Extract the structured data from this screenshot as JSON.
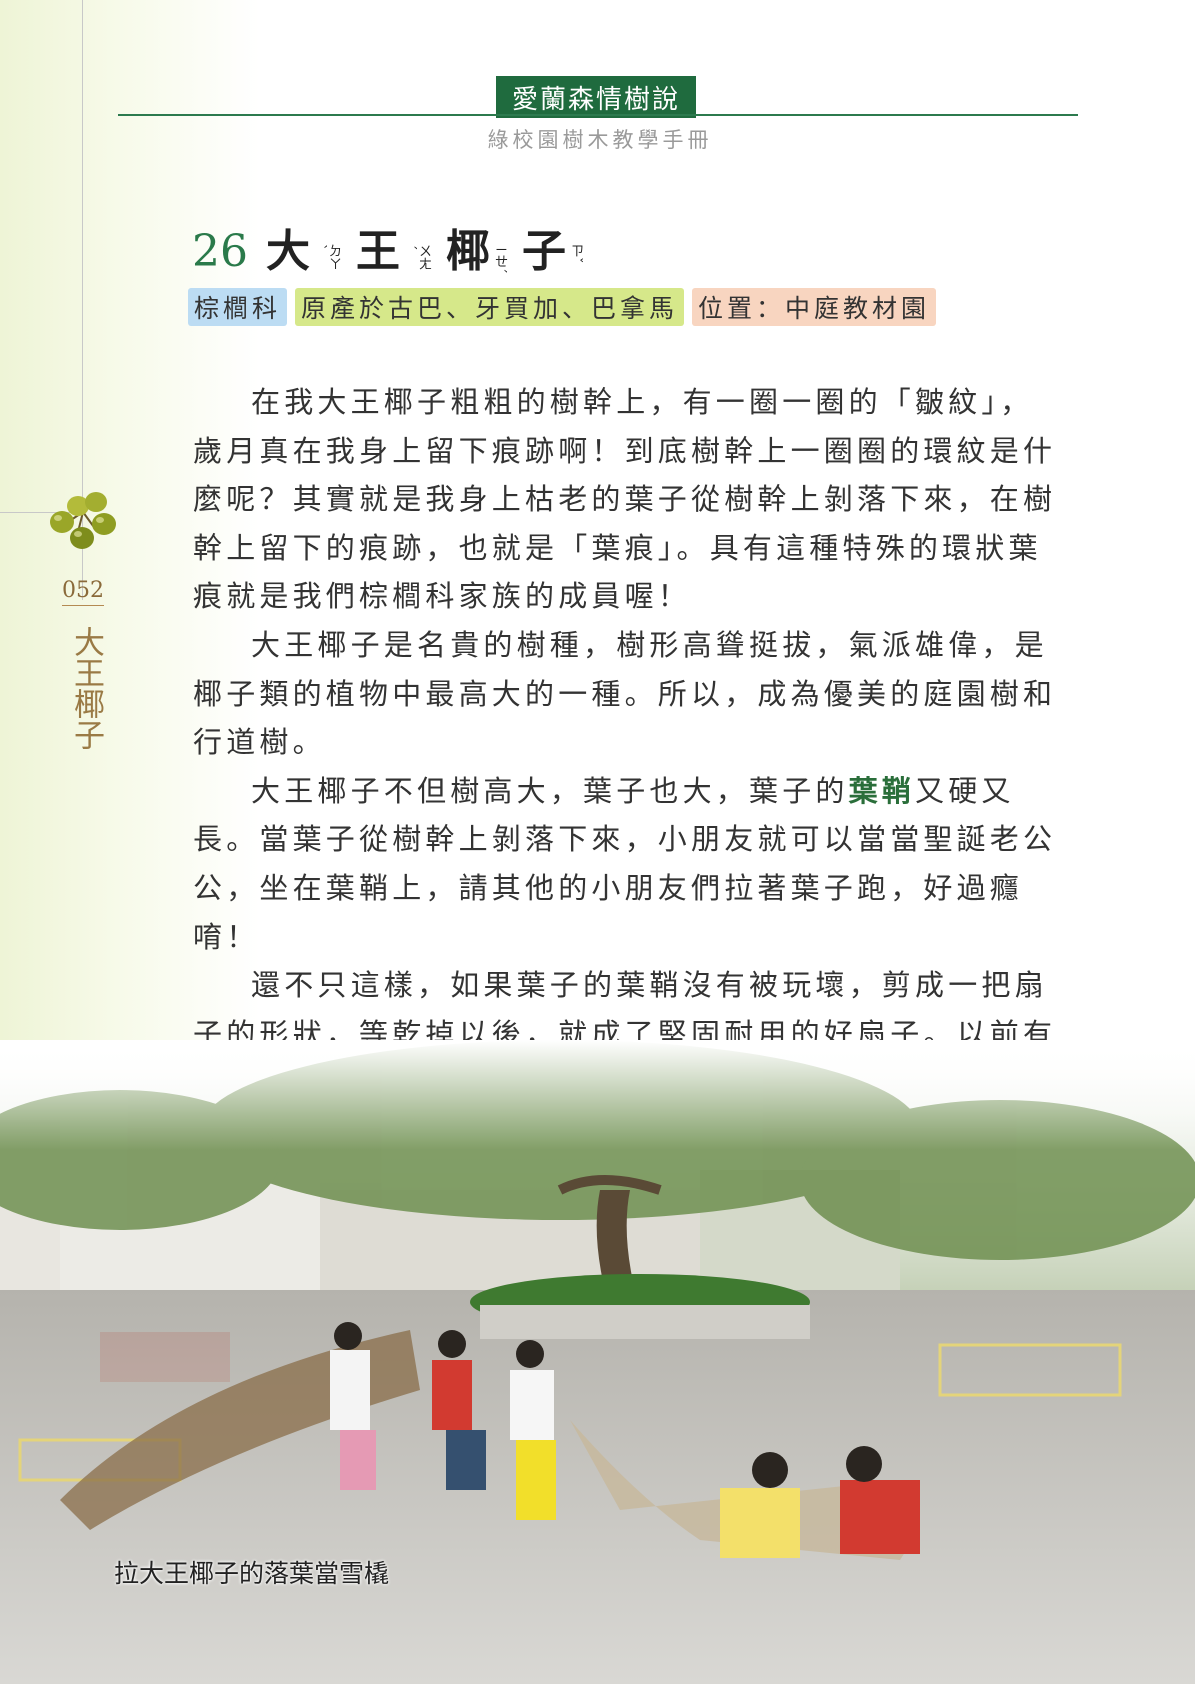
{
  "header": {
    "series_title": "愛蘭森情樹說",
    "series_subtitle": "綠校園樹木教學手冊"
  },
  "sidebar": {
    "page_number": "052",
    "vertical_title": "大王椰子"
  },
  "article": {
    "number": "26",
    "title_chars": [
      {
        "char": "大",
        "zhuyin": "ㄉㄚˋ"
      },
      {
        "char": "王",
        "zhuyin": "ㄨㄤˊ"
      },
      {
        "char": "椰",
        "zhuyin": "ㄧㄝˊ"
      },
      {
        "char": "子",
        "zhuyin": "ㄗˇ"
      }
    ],
    "tags": {
      "family": "棕櫚科",
      "origin": "原產於古巴、牙買加、巴拿馬",
      "location": "位置：中庭教材園"
    },
    "paragraphs": [
      {
        "text": "在我大王椰子粗粗的樹幹上，有一圈一圈的「皺紋」，歲月真在我身上留下痕跡啊！到底樹幹上一圈圈的環紋是什麼呢？其實就是我身上枯老的葉子從樹幹上剝落下來，在樹幹上留下的痕跡，也就是「葉痕」。具有這種特殊的環狀葉痕就是我們棕櫚科家族的成員喔！"
      },
      {
        "text": "大王椰子是名貴的樹種，樹形高聳挺拔，氣派雄偉，是椰子類的植物中最高大的一種。所以，成為優美的庭園樹和行道樹。"
      },
      {
        "before": "大王椰子不但樹高大，葉子也大，葉子的",
        "highlight": "葉鞘",
        "after": "又硬又長。當葉子從樹幹上剝落下來，小朋友就可以當當聖誕老公公，坐在葉鞘上，請其他的小朋友們拉著葉子跑，好過癮唷！"
      },
      {
        "text": "還不只這樣，如果葉子的葉鞘沒有被玩壞，剪成一把扇子的形狀，等乾掉以後，就成了堅固耐用的好扇子。以前有些人就是這樣利用檳榔樹的葉鞘來當扇子的喔！「一把扇子七寸長，一人扇風二人涼。」你要不要試試看？"
      }
    ],
    "photo_caption": "拉大王椰子的落葉當雪橇"
  },
  "colors": {
    "accent_green": "#1f6b3e",
    "tag_family_bg": "#bcdcf3",
    "tag_origin_bg": "#d6e88a",
    "tag_location_bg": "#f8d5c0"
  }
}
